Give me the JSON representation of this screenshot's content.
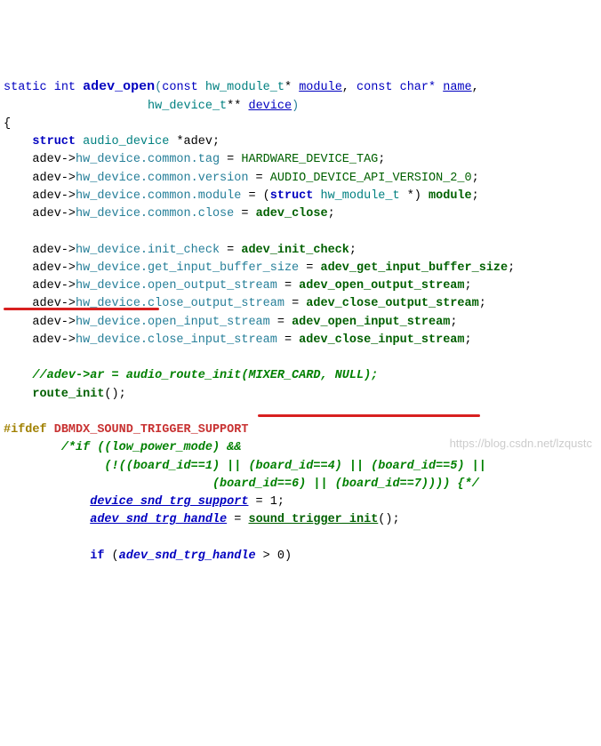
{
  "line1": {
    "static": "static ",
    "int": "int ",
    "fn": "adev_open",
    "p1": "const ",
    "t1": "hw_module_t",
    "star1": "* ",
    "module": "module",
    "c1": ", ",
    "p2": "const char* ",
    "name": "name",
    "c2": ","
  },
  "line2": {
    "pad": "                    ",
    "t": "hw_device_t",
    "star": "** ",
    "dev": "device",
    "close": ")"
  },
  "line3": "{",
  "l4": {
    "pad": "    ",
    "kw": "struct ",
    "t": "audio_device",
    "rest": " *adev;"
  },
  "l5": {
    "pad": "    ",
    "a": "adev->",
    "b": "hw_device.common.tag",
    " = ": " = ",
    "c": "HARDWARE_DEVICE_TAG",
    "d": ";"
  },
  "l6": {
    "pad": "    ",
    "a": "adev->",
    "b": "hw_device.common.version",
    " = ": " = ",
    "c": "AUDIO_DEVICE_API_VERSION_2_0",
    "d": ";"
  },
  "l7": {
    "pad": "    ",
    "a": "adev->",
    "b": "hw_device.common.module",
    " = ": " = (",
    "c": "struct ",
    "d": "hw_module_t",
    " *": " *) ",
    "e": "module",
    "f": ";"
  },
  "l8": {
    "pad": "    ",
    "a": "adev->",
    "b": "hw_device.common.close",
    " = ": " = ",
    "c": "adev_close",
    "d": ";"
  },
  "l10": {
    "pad": "    ",
    "a": "adev->",
    "b": "hw_device.init_check",
    " = ": " = ",
    "c": "adev_init_check",
    "d": ";"
  },
  "l11": {
    "pad": "    ",
    "a": "adev->",
    "b": "hw_device.get_input_buffer_size",
    " = ": " = ",
    "c": "adev_get_input_buffer_size",
    "d": ";"
  },
  "l12": {
    "pad": "    ",
    "a": "adev->",
    "b": "hw_device.open_output_stream",
    " = ": " = ",
    "c": "adev_open_output_stream",
    "d": ";"
  },
  "l13": {
    "pad": "    ",
    "a": "adev->",
    "b": "hw_device.close_output_stream",
    " = ": " = ",
    "c": "adev_close_output_stream",
    "d": ";"
  },
  "l14": {
    "pad": "    ",
    "a": "adev->",
    "b": "hw_device.open_input_stream",
    " = ": " = ",
    "c": "adev_open_input_stream",
    "d": ";"
  },
  "l15": {
    "pad": "    ",
    "a": "adev->",
    "b": "hw_device.close_input_stream",
    " = ": " = ",
    "c": "adev_close_input_stream",
    "d": ";"
  },
  "l17": {
    "pad": "    ",
    "txt": "//adev->ar = audio_route_init(MIXER_CARD, NULL);"
  },
  "l18": {
    "pad": "    ",
    "fn": "route_init",
    "rest": "();"
  },
  "l20": {
    "ifdef": "#ifdef ",
    "sym": "DBMDX_SOUND_TRIGGER_SUPPORT"
  },
  "l21": {
    "pad": "        ",
    "txt": "/*if ((low_power_mode) &&"
  },
  "l22": {
    "pad": "              ",
    "txt": "(!((board_id==1) || (board_id==4) || (board_id==5) ||"
  },
  "l23": {
    "pad": "                             ",
    "txt": "(board_id==6) || (board_id==7)))) {*/"
  },
  "l24": {
    "pad": "            ",
    "a": "device_snd_trg_support",
    " = ": " = ",
    "b": "1",
    "c": ";"
  },
  "l25": {
    "pad": "            ",
    "a": "adev_snd_trg_handle",
    " = ": " = ",
    "b": "sound_trigger_init",
    "c": "();"
  },
  "l27": {
    "pad": "            ",
    "kw": "if ",
    "a": "(",
    "b": "adev_snd_trg_handle",
    "c": " > ",
    "d": "0",
    "e": ")"
  },
  "watermark": "https://blog.csdn.net/lzqustc"
}
